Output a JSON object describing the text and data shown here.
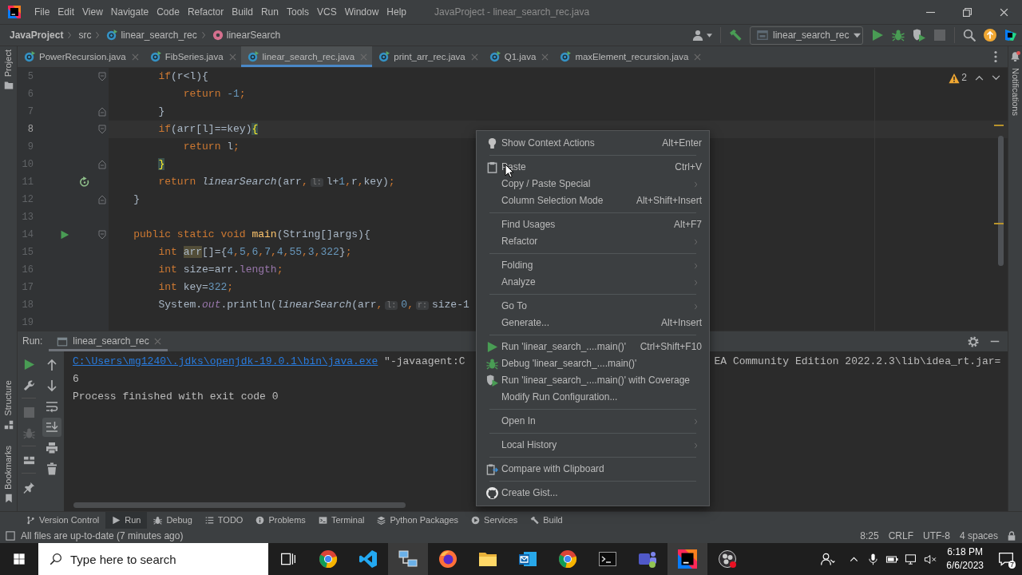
{
  "title_bar": {
    "menu": [
      "File",
      "Edit",
      "View",
      "Navigate",
      "Code",
      "Refactor",
      "Build",
      "Run",
      "Tools",
      "VCS",
      "Window",
      "Help"
    ],
    "title": "JavaProject - linear_search_rec.java"
  },
  "breadcrumbs": [
    {
      "kind": "project",
      "label": "JavaProject"
    },
    {
      "kind": "directory",
      "label": "src"
    },
    {
      "kind": "class",
      "label": "linear_search_rec"
    },
    {
      "kind": "method",
      "label": "linearSearch"
    }
  ],
  "run_configuration": {
    "label": "linear_search_rec"
  },
  "toolbar_actions": [
    {
      "disabled": false
    },
    {
      "disabled": false
    },
    {
      "disabled": false
    },
    {
      "disabled": true
    }
  ],
  "editor_tabs": [
    {
      "label": "PowerRecursion.java",
      "selected": false
    },
    {
      "label": "FibSeries.java",
      "selected": false
    },
    {
      "label": "linear_search_rec.java",
      "selected": true
    },
    {
      "label": "print_arr_rec.java",
      "selected": false
    },
    {
      "label": "Q1.java",
      "selected": false
    },
    {
      "label": "maxElement_recursion.java",
      "selected": false
    }
  ],
  "left_tool_strip": {
    "top": [
      {
        "label": "Project"
      }
    ],
    "bottom": [
      {
        "label": "Structure"
      },
      {
        "label": "Bookmarks"
      }
    ]
  },
  "right_tool_strip": [
    {
      "label": "Notifications"
    }
  ],
  "editor": {
    "warning_count": "2",
    "lines": [
      {
        "number": "5",
        "current": false,
        "fold_start": true,
        "fold_end": false,
        "runnable": false,
        "recursive_call": false,
        "tokens": [
          {
            "kind": "keyword",
            "text": "        if"
          },
          {
            "kind": "plain",
            "text": "(r<l){"
          }
        ]
      },
      {
        "number": "6",
        "current": false,
        "fold_start": false,
        "fold_end": false,
        "runnable": false,
        "recursive_call": false,
        "tokens": [
          {
            "kind": "keyword",
            "text": "            return"
          },
          {
            "kind": "number",
            "text": " -1"
          },
          {
            "kind": "punct",
            "text": ";"
          }
        ]
      },
      {
        "number": "7",
        "current": false,
        "fold_start": false,
        "fold_end": true,
        "runnable": false,
        "recursive_call": false,
        "tokens": [
          {
            "kind": "plain",
            "text": "        }"
          }
        ]
      },
      {
        "number": "8",
        "current": true,
        "fold_start": true,
        "fold_end": false,
        "runnable": false,
        "recursive_call": false,
        "tokens": [
          {
            "kind": "keyword",
            "text": "        if"
          },
          {
            "kind": "plain",
            "text": "(arr[l]==key)"
          },
          {
            "kind": "brace-match",
            "text": "{"
          }
        ]
      },
      {
        "number": "9",
        "current": false,
        "fold_start": false,
        "fold_end": false,
        "runnable": false,
        "recursive_call": false,
        "tokens": [
          {
            "kind": "keyword",
            "text": "            return"
          },
          {
            "kind": "plain",
            "text": " l"
          },
          {
            "kind": "punct",
            "text": ";"
          }
        ]
      },
      {
        "number": "10",
        "current": false,
        "fold_start": false,
        "fold_end": true,
        "runnable": false,
        "recursive_call": false,
        "tokens": [
          {
            "kind": "brace-match",
            "text": "        }"
          }
        ]
      },
      {
        "number": "11",
        "current": false,
        "fold_start": false,
        "fold_end": false,
        "runnable": false,
        "recursive_call": true,
        "tokens": [
          {
            "kind": "keyword",
            "text": "        return"
          },
          {
            "kind": "static-call",
            "text": " linearSearch"
          },
          {
            "kind": "plain",
            "text": "(arr"
          },
          {
            "kind": "punct",
            "text": ","
          },
          {
            "kind": "hint",
            "text": "l:"
          },
          {
            "kind": "plain",
            "text": "l+"
          },
          {
            "kind": "number",
            "text": "1"
          },
          {
            "kind": "punct",
            "text": ","
          },
          {
            "kind": "plain",
            "text": "r"
          },
          {
            "kind": "punct",
            "text": ","
          },
          {
            "kind": "plain",
            "text": "key)"
          },
          {
            "kind": "punct",
            "text": ";"
          }
        ]
      },
      {
        "number": "12",
        "current": false,
        "fold_start": false,
        "fold_end": true,
        "runnable": false,
        "recursive_call": false,
        "tokens": [
          {
            "kind": "plain",
            "text": "    }"
          }
        ]
      },
      {
        "number": "13",
        "current": false,
        "fold_start": false,
        "fold_end": false,
        "runnable": false,
        "recursive_call": false
      },
      {
        "number": "14",
        "current": false,
        "fold_start": true,
        "fold_end": false,
        "runnable": true,
        "recursive_call": false,
        "tokens": [
          {
            "kind": "keyword",
            "text": "    public static void"
          },
          {
            "kind": "method-declaration",
            "text": " main"
          },
          {
            "kind": "plain",
            "text": "(String[]args){"
          }
        ]
      },
      {
        "number": "15",
        "current": false,
        "fold_start": false,
        "fold_end": false,
        "runnable": false,
        "recursive_call": false,
        "tokens": [
          {
            "kind": "keyword",
            "text": "        int "
          },
          {
            "kind": "usage",
            "text": "arr"
          },
          {
            "kind": "plain",
            "text": "[]={"
          },
          {
            "kind": "number",
            "text": "4"
          },
          {
            "kind": "punct",
            "text": ","
          },
          {
            "kind": "number",
            "text": "5"
          },
          {
            "kind": "punct",
            "text": ","
          },
          {
            "kind": "number",
            "text": "6"
          },
          {
            "kind": "punct",
            "text": ","
          },
          {
            "kind": "number",
            "text": "7"
          },
          {
            "kind": "punct",
            "text": ","
          },
          {
            "kind": "number",
            "text": "4"
          },
          {
            "kind": "punct",
            "text": ","
          },
          {
            "kind": "number",
            "text": "55"
          },
          {
            "kind": "punct",
            "text": ","
          },
          {
            "kind": "number",
            "text": "3"
          },
          {
            "kind": "punct",
            "text": ","
          },
          {
            "kind": "number",
            "text": "322"
          },
          {
            "kind": "plain",
            "text": "}"
          },
          {
            "kind": "punct",
            "text": ";"
          }
        ]
      },
      {
        "number": "16",
        "current": false,
        "fold_start": false,
        "fold_end": false,
        "runnable": false,
        "recursive_call": false,
        "tokens": [
          {
            "kind": "keyword",
            "text": "        int"
          },
          {
            "kind": "plain",
            "text": " size=arr."
          },
          {
            "kind": "member",
            "text": "length"
          },
          {
            "kind": "punct",
            "text": ";"
          }
        ]
      },
      {
        "number": "17",
        "current": false,
        "fold_start": false,
        "fold_end": false,
        "runnable": false,
        "recursive_call": false,
        "tokens": [
          {
            "kind": "keyword",
            "text": "        int"
          },
          {
            "kind": "plain",
            "text": " key="
          },
          {
            "kind": "number",
            "text": "322"
          },
          {
            "kind": "punct",
            "text": ";"
          }
        ]
      },
      {
        "number": "18",
        "current": false,
        "fold_start": false,
        "fold_end": false,
        "runnable": false,
        "recursive_call": false,
        "tokens": [
          {
            "kind": "plain",
            "text": "        System."
          },
          {
            "kind": "field",
            "text": "out"
          },
          {
            "kind": "plain",
            "text": ".println("
          },
          {
            "kind": "static-call",
            "text": "linearSearch"
          },
          {
            "kind": "plain",
            "text": "(arr"
          },
          {
            "kind": "punct",
            "text": ","
          },
          {
            "kind": "hint",
            "text": "l:"
          },
          {
            "kind": "number",
            "text": "0"
          },
          {
            "kind": "punct",
            "text": ","
          },
          {
            "kind": "hint",
            "text": "r:"
          },
          {
            "kind": "plain",
            "text": "size-1"
          }
        ]
      },
      {
        "number": "19",
        "current": false,
        "fold_start": false,
        "fold_end": false,
        "runnable": false,
        "recursive_call": false
      }
    ]
  },
  "run_panel": {
    "title": "Run:",
    "tabs": [
      {
        "label": "linear_search_rec",
        "selected": true
      }
    ],
    "run_toolbar": [
      {
        "disabled": false
      },
      {
        "disabled": false
      },
      {
        "disabled": true
      },
      {
        "disabled": true
      },
      {
        "disabled": false
      },
      {
        "disabled": false
      }
    ],
    "console_toolbar": [
      {
        "toggled": false
      },
      {
        "toggled": false
      },
      {
        "toggled": false
      },
      {
        "toggled": true
      },
      {
        "toggled": false
      },
      {
        "toggled": false
      }
    ],
    "console": [
      {
        "kind": "command",
        "path": "C:\\Users\\mg1240\\.jdks\\openjdk-19.0.1\\bin\\java.exe",
        "args_head": "\"-javaagent:C",
        "args_tail": "EA Community Edition 2022.2.3\\lib\\idea_rt.jar="
      },
      {
        "kind": "output",
        "text": "6"
      },
      {
        "kind": "output",
        "text": "Process finished with exit code 0"
      }
    ]
  },
  "context_menu": {
    "groups": [
      [
        {
          "label": "Show Context Actions",
          "shortcut": "Alt+Enter",
          "has_submenu": false
        }
      ],
      [
        {
          "label": "Paste",
          "shortcut": "Ctrl+V",
          "has_submenu": false
        },
        {
          "label": "Copy / Paste Special",
          "has_submenu": true
        },
        {
          "label": "Column Selection Mode",
          "shortcut": "Alt+Shift+Insert",
          "has_submenu": false
        }
      ],
      [
        {
          "label": "Find Usages",
          "shortcut": "Alt+F7",
          "has_submenu": false
        },
        {
          "label": "Refactor",
          "has_submenu": true
        }
      ],
      [
        {
          "label": "Folding",
          "has_submenu": true
        },
        {
          "label": "Analyze",
          "has_submenu": true
        }
      ],
      [
        {
          "label": "Go To",
          "has_submenu": true
        },
        {
          "label": "Generate...",
          "shortcut": "Alt+Insert",
          "has_submenu": false
        }
      ],
      [
        {
          "label": "Run 'linear_search_....main()'",
          "shortcut": "Ctrl+Shift+F10",
          "has_submenu": false
        },
        {
          "label": "Debug 'linear_search_....main()'",
          "has_submenu": false
        },
        {
          "label": "Run 'linear_search_....main()' with Coverage",
          "has_submenu": false
        },
        {
          "label": "Modify Run Configuration...",
          "has_submenu": false
        }
      ],
      [
        {
          "label": "Open In",
          "has_submenu": true
        }
      ],
      [
        {
          "label": "Local History",
          "has_submenu": true
        }
      ],
      [
        {
          "label": "Compare with Clipboard",
          "has_submenu": false
        }
      ],
      [
        {
          "label": "Create Gist...",
          "has_submenu": false
        }
      ]
    ]
  },
  "tool_window_bar": [
    {
      "label": "Version Control",
      "selected": false
    },
    {
      "label": "Run",
      "selected": true
    },
    {
      "label": "Debug",
      "selected": false
    },
    {
      "label": "TODO",
      "selected": false
    },
    {
      "label": "Problems",
      "selected": false
    },
    {
      "label": "Terminal",
      "selected": false
    },
    {
      "label": "Python Packages",
      "selected": false
    },
    {
      "label": "Services",
      "selected": false
    },
    {
      "label": "Build",
      "selected": false
    }
  ],
  "status_bar": {
    "message": "All files are up-to-date (7 minutes ago)",
    "widgets": [
      "8:25",
      "CRLF",
      "UTF-8",
      "4 spaces"
    ]
  },
  "taskbar": {
    "search": {
      "placeholder": "Type here to search"
    },
    "apps": [
      {
        "active": false
      },
      {
        "active": false
      },
      {
        "active": false
      },
      {
        "active": true
      },
      {
        "active": false
      },
      {
        "active": false
      },
      {
        "active": false
      },
      {
        "active": false
      },
      {
        "active": false
      },
      {
        "active": false
      },
      {
        "active": true
      },
      {
        "active": false
      }
    ],
    "time": "6:18 PM",
    "date": "6/6/2023",
    "notification_count": "7"
  }
}
